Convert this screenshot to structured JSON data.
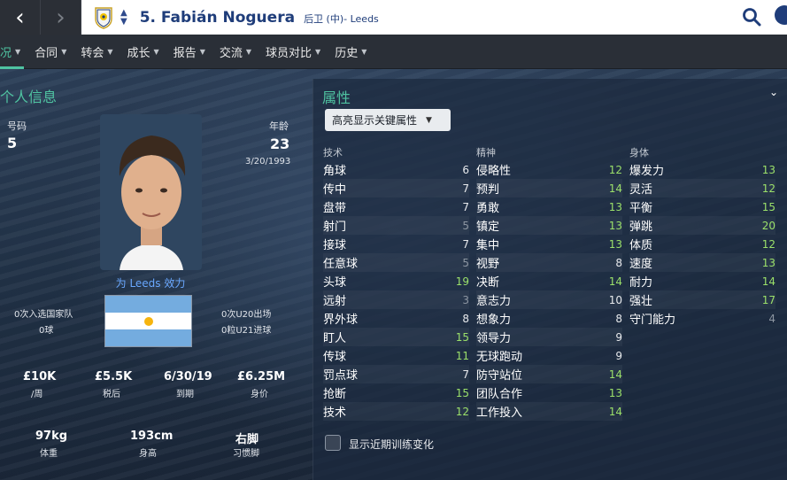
{
  "header": {
    "player_title": "5. Fabián Noguera",
    "player_sub": "后卫 (中)- Leeds"
  },
  "menu": [
    {
      "label": "况",
      "active": true
    },
    {
      "label": "合同",
      "active": false
    },
    {
      "label": "转会",
      "active": false
    },
    {
      "label": "成长",
      "active": false
    },
    {
      "label": "报告",
      "active": false
    },
    {
      "label": "交流",
      "active": false
    },
    {
      "label": "球员对比",
      "active": false
    },
    {
      "label": "历史",
      "active": false
    }
  ],
  "personal": {
    "title": "个人信息",
    "number_label": "号码",
    "number": "5",
    "age_label": "年龄",
    "age": "23",
    "dob": "3/20/1993",
    "plays_for": "为 Leeds 效力",
    "caps_label": "0次入选国家队",
    "goals_label": "0球",
    "u20_label": "0次U20出场",
    "u21_label": "0粒U21进球",
    "wage": "£10K",
    "wage_label": "/周",
    "after_tax": "£5.5K",
    "after_tax_label": "税后",
    "expires": "6/30/19",
    "expires_label": "到期",
    "value": "£6.25M",
    "value_label": "身价",
    "weight": "97kg",
    "weight_label": "体重",
    "height": "193cm",
    "height_label": "身高",
    "foot": "右脚",
    "foot_label": "习惯脚",
    "flag_colors": [
      "#74acdf",
      "#ffffff",
      "#74acdf"
    ]
  },
  "attributes": {
    "title": "属性",
    "dropdown": "高亮显示关键属性",
    "checkbox_label": "显示近期训练变化",
    "columns": [
      {
        "header": "技术",
        "items": [
          {
            "name": "角球",
            "value": "6",
            "tone": "w"
          },
          {
            "name": "传中",
            "value": "7",
            "tone": "w"
          },
          {
            "name": "盘带",
            "value": "7",
            "tone": "w"
          },
          {
            "name": "射门",
            "value": "5",
            "tone": "dim"
          },
          {
            "name": "接球",
            "value": "7",
            "tone": "w"
          },
          {
            "name": "任意球",
            "value": "5",
            "tone": "dim"
          },
          {
            "name": "头球",
            "value": "19",
            "tone": "g"
          },
          {
            "name": "远射",
            "value": "3",
            "tone": "dim"
          },
          {
            "name": "界外球",
            "value": "8",
            "tone": "w"
          },
          {
            "name": "盯人",
            "value": "15",
            "tone": "g"
          },
          {
            "name": "传球",
            "value": "11",
            "tone": "g"
          },
          {
            "name": "罚点球",
            "value": "7",
            "tone": "w"
          },
          {
            "name": "抢断",
            "value": "15",
            "tone": "g"
          },
          {
            "name": "技术",
            "value": "12",
            "tone": "g"
          }
        ]
      },
      {
        "header": "精神",
        "items": [
          {
            "name": "侵略性",
            "value": "12",
            "tone": "g"
          },
          {
            "name": "预判",
            "value": "14",
            "tone": "g"
          },
          {
            "name": "勇敢",
            "value": "13",
            "tone": "g"
          },
          {
            "name": "镇定",
            "value": "13",
            "tone": "g"
          },
          {
            "name": "集中",
            "value": "13",
            "tone": "g"
          },
          {
            "name": "视野",
            "value": "8",
            "tone": "w"
          },
          {
            "name": "决断",
            "value": "14",
            "tone": "g"
          },
          {
            "name": "意志力",
            "value": "10",
            "tone": "w"
          },
          {
            "name": "想象力",
            "value": "8",
            "tone": "w"
          },
          {
            "name": "领导力",
            "value": "9",
            "tone": "w"
          },
          {
            "name": "无球跑动",
            "value": "9",
            "tone": "w"
          },
          {
            "name": "防守站位",
            "value": "14",
            "tone": "g"
          },
          {
            "name": "团队合作",
            "value": "13",
            "tone": "g"
          },
          {
            "name": "工作投入",
            "value": "14",
            "tone": "g"
          }
        ]
      },
      {
        "header": "身体",
        "items": [
          {
            "name": "爆发力",
            "value": "13",
            "tone": "g"
          },
          {
            "name": "灵活",
            "value": "12",
            "tone": "g"
          },
          {
            "name": "平衡",
            "value": "15",
            "tone": "g"
          },
          {
            "name": "弹跳",
            "value": "20",
            "tone": "g"
          },
          {
            "name": "体质",
            "value": "12",
            "tone": "g"
          },
          {
            "name": "速度",
            "value": "13",
            "tone": "g"
          },
          {
            "name": "耐力",
            "value": "14",
            "tone": "g"
          },
          {
            "name": "强壮",
            "value": "17",
            "tone": "g"
          },
          {
            "name": "守门能力",
            "value": "4",
            "tone": "dim"
          }
        ]
      }
    ]
  }
}
